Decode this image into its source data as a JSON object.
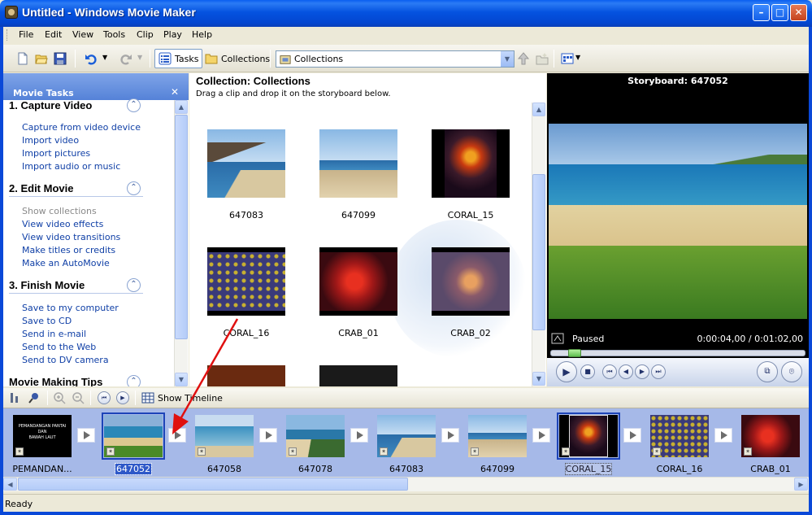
{
  "window": {
    "title": "Untitled - Windows Movie Maker",
    "minimize_glyph": "–",
    "maximize_glyph": "□",
    "close_glyph": "✕"
  },
  "menu": [
    "File",
    "Edit",
    "View",
    "Tools",
    "Clip",
    "Play",
    "Help"
  ],
  "toolbar": {
    "tasks_label": "Tasks",
    "collections_label": "Collections",
    "combo_value": "Collections",
    "icons": [
      "new-icon",
      "open-icon",
      "save-icon",
      "undo-icon",
      "redo-icon",
      "collection-up-icon",
      "new-collection-icon",
      "views-icon"
    ]
  },
  "task_pane": {
    "header": "Movie Tasks",
    "close_glyph": "✕",
    "sections": [
      {
        "title": "1. Capture Video",
        "links": [
          "Capture from video device",
          "Import video",
          "Import pictures",
          "Import audio or music"
        ]
      },
      {
        "title": "2. Edit Movie",
        "links": [
          "Show collections",
          "View video effects",
          "View video transitions",
          "Make titles or credits",
          "Make an AutoMovie"
        ]
      },
      {
        "title": "3. Finish Movie",
        "links": [
          "Save to my computer",
          "Save to CD",
          "Send in e-mail",
          "Send to the Web",
          "Send to DV camera"
        ]
      },
      {
        "title": "Movie Making Tips",
        "links": []
      }
    ],
    "collapse_glyph": "⌃"
  },
  "collection": {
    "title": "Collection: Collections",
    "subtitle": "Drag a clip and drop it on the storyboard below.",
    "clips": [
      "647083",
      "647099",
      "CORAL_15",
      "CORAL_16",
      "CRAB_01",
      "CRAB_02"
    ]
  },
  "preview": {
    "title": "Storyboard: 647052",
    "status": "Paused",
    "time": "0:00:04,00 / 0:01:02,00",
    "seek_position": 0.07
  },
  "storyboard_toolbar": {
    "show_timeline_label": "Show Timeline"
  },
  "storyboard": {
    "items": [
      "PEMANDAN...",
      "647052",
      "647058",
      "647078",
      "647083",
      "647099",
      "CORAL_15",
      "CORAL_16",
      "CRAB_01"
    ],
    "title_slide_lines": [
      "PEMANDANGAN PANTAI",
      "DAN",
      "BAWAH LAUT"
    ],
    "selected": [
      "647052",
      "CORAL_15"
    ]
  },
  "status_bar": {
    "text": "Ready"
  },
  "colors": {
    "titlebar": "#0553e0",
    "selection": "#2e58c8",
    "storyboard_bg": "#a6b9e8",
    "annotation_arrow": "#e01010"
  }
}
